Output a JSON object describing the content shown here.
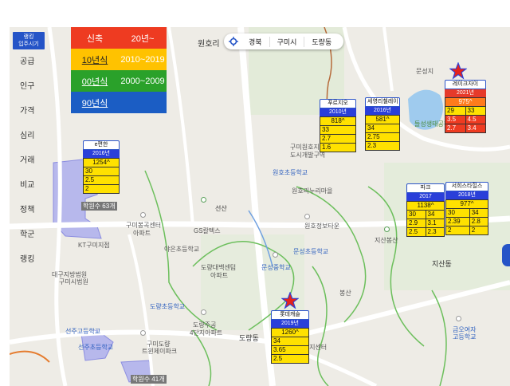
{
  "sidebar": {
    "header": [
      "랭킹",
      "입주시기"
    ],
    "items": [
      "공급",
      "인구",
      "가격",
      "심리",
      "거래",
      "비교",
      "정책",
      "학군",
      "랭킹"
    ]
  },
  "legend": {
    "rows": [
      {
        "label": "신축",
        "range": "20년~",
        "color": "#ee3b21"
      },
      {
        "label": "10년식",
        "range": "2010~2019",
        "color": "#ffc200"
      },
      {
        "label": "00년식",
        "range": "2000~2009",
        "color": "#2aa12a"
      },
      {
        "label": "90년식",
        "range": "",
        "color": "#1b5dc4"
      }
    ]
  },
  "searchbar": {
    "region1": "경북",
    "region2": "구미시",
    "region3": "도량동"
  },
  "apartments": [
    {
      "name": "e편한",
      "year": "2016년",
      "price": "1254^",
      "rows": [
        "30",
        "2.5",
        "2"
      ],
      "theme": "yellow"
    },
    {
      "name": "푸르지오",
      "year": "2010년",
      "price": "818^",
      "rows": [
        "33",
        "2.7",
        "1.6"
      ],
      "theme": "yellow"
    },
    {
      "name": "세영리첼레이",
      "year": "2016년",
      "price": "581^",
      "rows": [
        "34",
        "2.75",
        "2.3"
      ],
      "theme": "yellow"
    },
    {
      "name": "레이크자이",
      "year": "2021년",
      "price": "975^",
      "rows": [
        [
          "29",
          "33"
        ],
        [
          "3.5",
          "4.5"
        ],
        [
          "2.7",
          "3.4"
        ]
      ],
      "theme": "red"
    },
    {
      "name": "파크",
      "year": "2017",
      "price": "1138^",
      "rows": [
        [
          "30",
          "34"
        ],
        [
          "2.9",
          "3.1"
        ],
        [
          "2.5",
          "2.3"
        ]
      ],
      "theme": "yellow"
    },
    {
      "name": "서희스타힐스",
      "year": "2018년",
      "price": "977^",
      "rows": [
        [
          "30",
          "34"
        ],
        [
          "2.39",
          "2.8"
        ],
        [
          "2",
          "2"
        ]
      ],
      "theme": "yellow"
    },
    {
      "name": "롯데캐슬",
      "year": "2019년",
      "price": "1260^",
      "rows": [
        "34",
        "3.65",
        "2.5"
      ],
      "theme": "yellow"
    }
  ],
  "map_labels": {
    "wonhori": "원호리",
    "sansun": "선산",
    "school_wonho": "원호초등학교",
    "wonhoriborn": "원호리누리마을",
    "wonho_center": "원호정보타운",
    "guminewdev": "구미원호지구",
    "citydev": "도시개발구역",
    "gumibongtae": "구미봉곡센터",
    "apt_lakeside": "아파트",
    "gs1": "GS칼텍스",
    "gs2": "GS칼텍스",
    "kt": "KT구미지점",
    "court": "대구지방법원",
    "court2": "구미시법원",
    "yaeun_school": "야은초등학교",
    "doryang_school": "도량초등학교",
    "doryang_apt": "도량주공",
    "doryang_apt2": "4단지아파트",
    "doryang_village": "도량동",
    "dorangtown": "도량대백센텀",
    "dorangtown2": "아파트",
    "wonhome": "도량동",
    "munseong_school": "문성초등학교",
    "munseong_middle": "문성중학교",
    "jisanbongsan": "지산봉산",
    "jisan": "지산동",
    "bongsan": "봉산",
    "geumo_school": "금오여자",
    "geumo_school2": "고등학교",
    "gumihigh": "구미도량",
    "gumihigh2": "트윈제이파크",
    "seonju": "선주고등학교",
    "seonju2": "선주초등학교",
    "haengjeong": "행정복지센터",
    "doryangdong_cent": "도량동",
    "lake_park": "들성생태공원",
    "munseong_lake": "문성지",
    "jisanjung": "지산중학교",
    "academy1": "학원수 63개",
    "academy2": "학원수 41개",
    "bukbu": "북부",
    "gumi_seobu": "구미서부",
    "gumiju": "구미봉곡2단지",
    "apt_small": "아파트"
  }
}
